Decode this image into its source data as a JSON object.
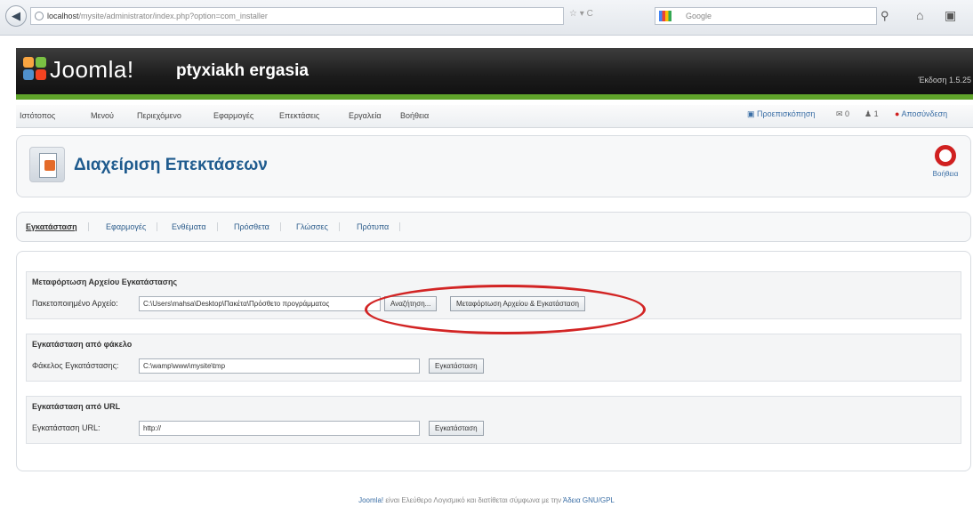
{
  "browser": {
    "url_host": "localhost",
    "url_path": "/mysite/administrator/index.php?option=com_installer",
    "search_engine": "Google"
  },
  "header": {
    "logo_text": "Joomla!",
    "site_name": "ptyxiakh ergasia",
    "version": "Έκδοση 1.5.25"
  },
  "menu": {
    "items": [
      "Ιστότοπος",
      "Μενού",
      "Περιεχόμενο",
      "Εφαρμογές",
      "Επεκτάσεις",
      "Εργαλεία",
      "Βοήθεια"
    ],
    "preview": "Προεπισκόπηση",
    "messages_count": "0",
    "users_count": "1",
    "logout": "Αποσύνδεση"
  },
  "toolbar": {
    "title": "Διαχείριση Επεκτάσεων",
    "help": "Βοήθεια"
  },
  "submenu": {
    "items": [
      "Εγκατάσταση",
      "Εφαρμογές",
      "Ενθέματα",
      "Πρόσθετα",
      "Γλώσσες",
      "Πρότυπα"
    ]
  },
  "upload": {
    "legend": "Μεταφόρτωση Αρχείου Εγκατάστασης",
    "label": "Πακετοποιημένο Αρχείο:",
    "value": "C:\\Users\\mahsa\\Desktop\\Πακέτα\\Πρόσθετο προγράμματος",
    "browse": "Αναζήτηση...",
    "submit": "Μεταφόρτωση Αρχείου & Εγκατάσταση"
  },
  "folder": {
    "legend": "Εγκατάσταση από φάκελο",
    "label": "Φάκελος Εγκατάστασης:",
    "value": "C:\\wamp\\www\\mysite\\tmp",
    "submit": "Εγκατάσταση"
  },
  "url_install": {
    "legend": "Εγκατάσταση από URL",
    "label": "Εγκατάσταση URL:",
    "value": "http://",
    "submit": "Εγκατάσταση"
  },
  "footer": {
    "link": "Joomla!",
    "text": "είναι Ελεύθερο Λογισμικό και διατίθεται σύμφωνα με την",
    "license": "Άδεια GNU/GPL"
  }
}
